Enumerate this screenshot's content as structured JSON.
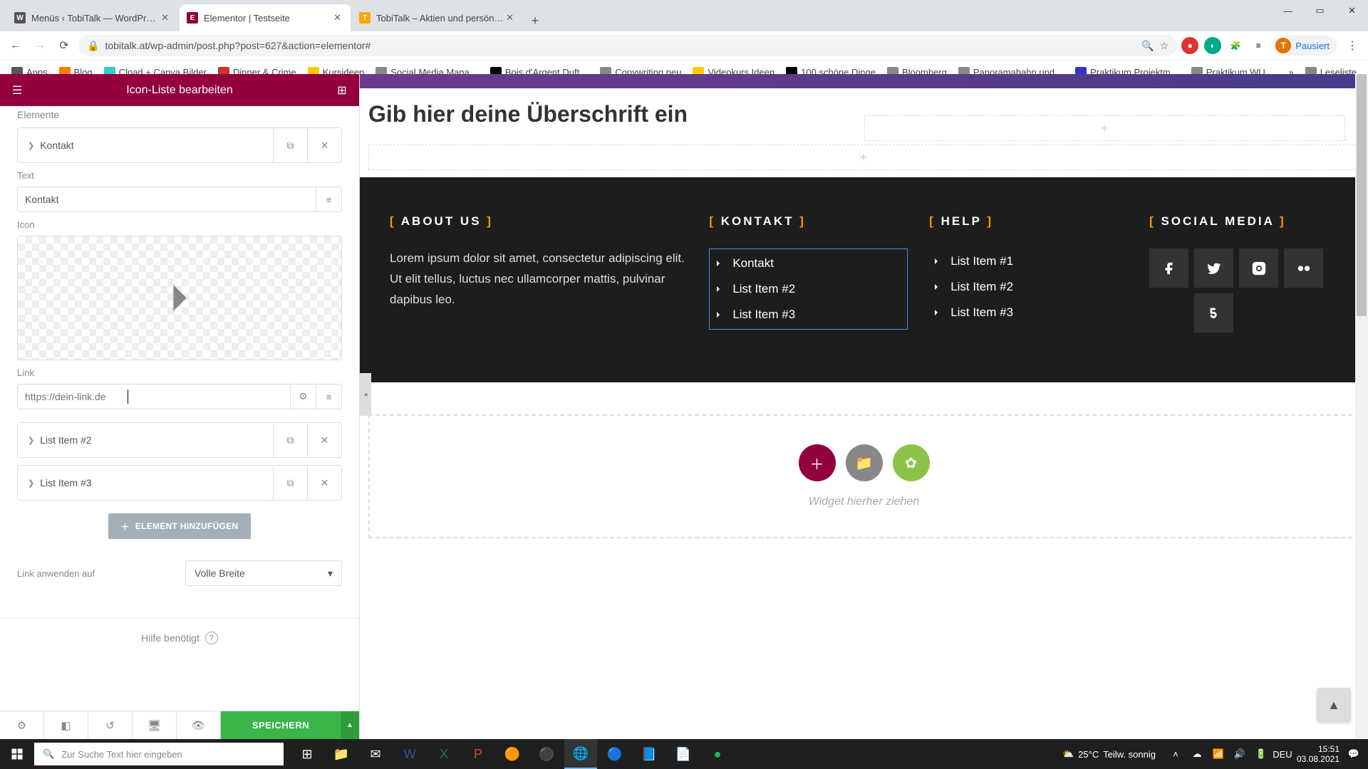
{
  "browser": {
    "tabs": [
      {
        "title": "Menüs ‹ TobiTalk — WordPress",
        "icon": "W"
      },
      {
        "title": "Elementor | Testseite",
        "icon": "E"
      },
      {
        "title": "TobiTalk – Aktien und persönlich…",
        "icon": "T"
      }
    ],
    "url": "tobitalk.at/wp-admin/post.php?post=627&action=elementor#",
    "profile_status": "Pausiert",
    "bookmarks": [
      "Apps",
      "Blog",
      "Cload + Canva Bilder",
      "Dinner & Crime",
      "Kursideen",
      "Social Media Mana…",
      "Bois d'Argent Duft…",
      "Copywriting neu",
      "Videokurs Ideen",
      "100 schöne Dinge",
      "Bloomberg",
      "Panoramabahn und…",
      "Praktikum Projektm…",
      "Praktikum WU"
    ],
    "reading_list": "Leseliste"
  },
  "panel": {
    "title": "Icon-Liste bearbeiten",
    "section_label": "Elemente",
    "items": [
      {
        "title": "Kontakt"
      },
      {
        "title": "List Item #2"
      },
      {
        "title": "List Item #3"
      }
    ],
    "text_label": "Text",
    "text_value": "Kontakt",
    "icon_label": "Icon",
    "link_label": "Link",
    "link_placeholder": "https://dein-link.de",
    "add_element": "ELEMENT HINZUFÜGEN",
    "link_apply_label": "Link anwenden auf",
    "link_apply_value": "Volle Breite",
    "help_label": "Hilfe benötigt",
    "save_label": "SPEICHERN"
  },
  "canvas": {
    "heading_placeholder": "Gib hier deine Überschrift ein",
    "footer_cols": {
      "about": {
        "heading": "ABOUT US",
        "text": "Lorem ipsum dolor sit amet, consectetur adipiscing elit. Ut elit tellus, luctus nec ullamcorper mattis, pulvinar dapibus leo."
      },
      "kontakt": {
        "heading": "KONTAKT",
        "items": [
          "Kontakt",
          "List Item #2",
          "List Item #3"
        ]
      },
      "help": {
        "heading": "HELP",
        "items": [
          "List Item #1",
          "List Item #2",
          "List Item #3"
        ]
      },
      "social": {
        "heading": "SOCIAL MEDIA"
      }
    },
    "drop_label": "Widget hierher ziehen"
  },
  "taskbar": {
    "search_placeholder": "Zur Suche Text hier eingeben",
    "weather_temp": "25°C",
    "weather_desc": "Teilw. sonnig",
    "time": "15:51",
    "date": "03.08.2021",
    "lang": "DEU"
  }
}
